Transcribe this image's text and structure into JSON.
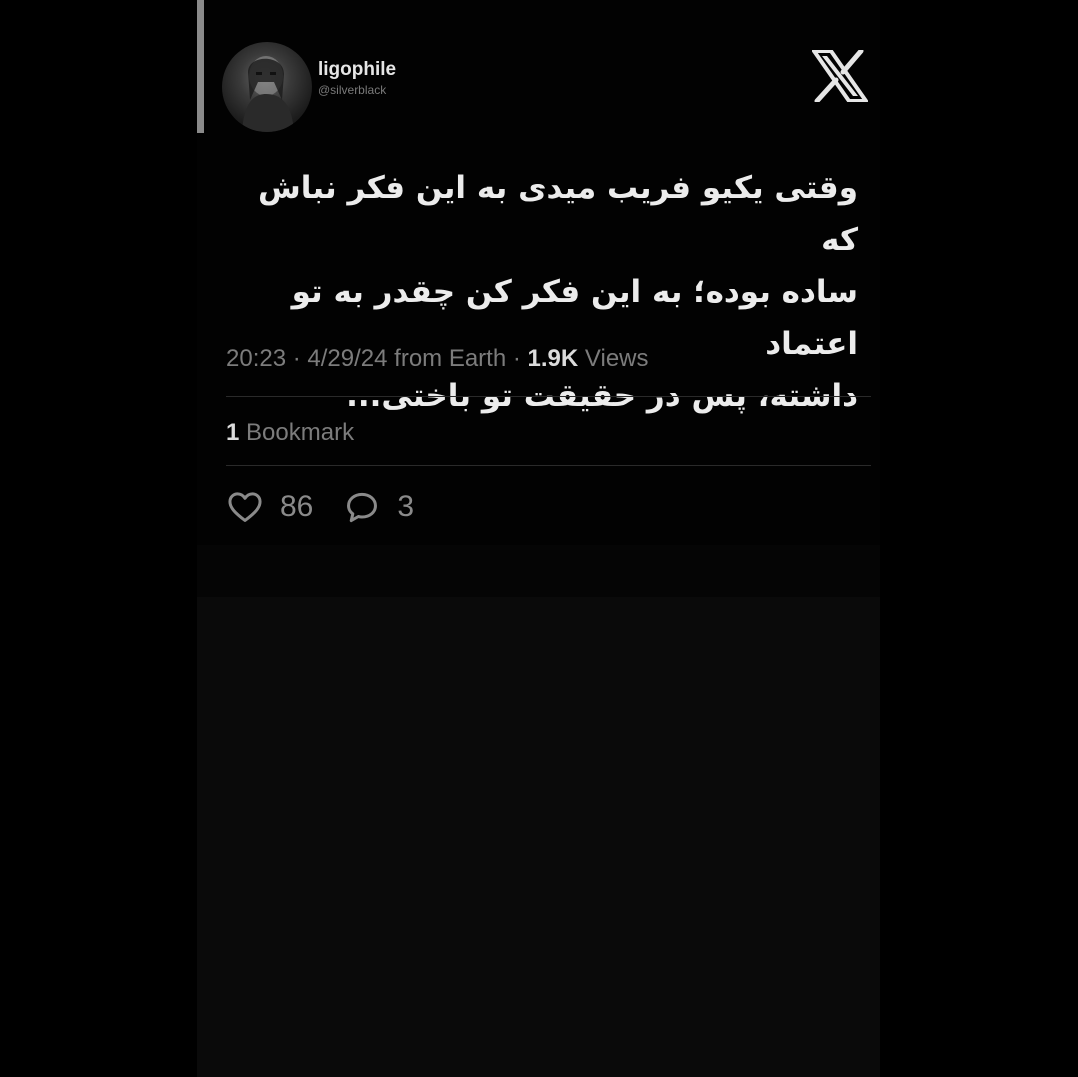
{
  "author": {
    "display_name": "ligophile",
    "handle": "@silverblack",
    "avatar_icon": "user-avatar-photo"
  },
  "brand": {
    "logo_icon": "x-logo-icon",
    "logo_color": "#e6e6e6"
  },
  "tweet": {
    "text_lines": [
      "وقتی یکیو فریب میدی به این فکر نباش که",
      "ساده بوده؛ به این فکر کن چقدر به تو اعتماد",
      "داشته، پس در حقیقت تو باختی..."
    ]
  },
  "meta": {
    "time": "20:23",
    "date": "4/29/24",
    "location": "from Earth",
    "separator": "·",
    "views_count": "1.9K",
    "views_label": "Views"
  },
  "engagement": {
    "bookmark_count": "1",
    "bookmark_label": "Bookmark",
    "like_count": "86",
    "reply_count": "3"
  },
  "colors": {
    "background": "#000000",
    "text_primary": "#ececec",
    "text_secondary": "#7c7c7c",
    "divider": "#2a2a2a"
  }
}
